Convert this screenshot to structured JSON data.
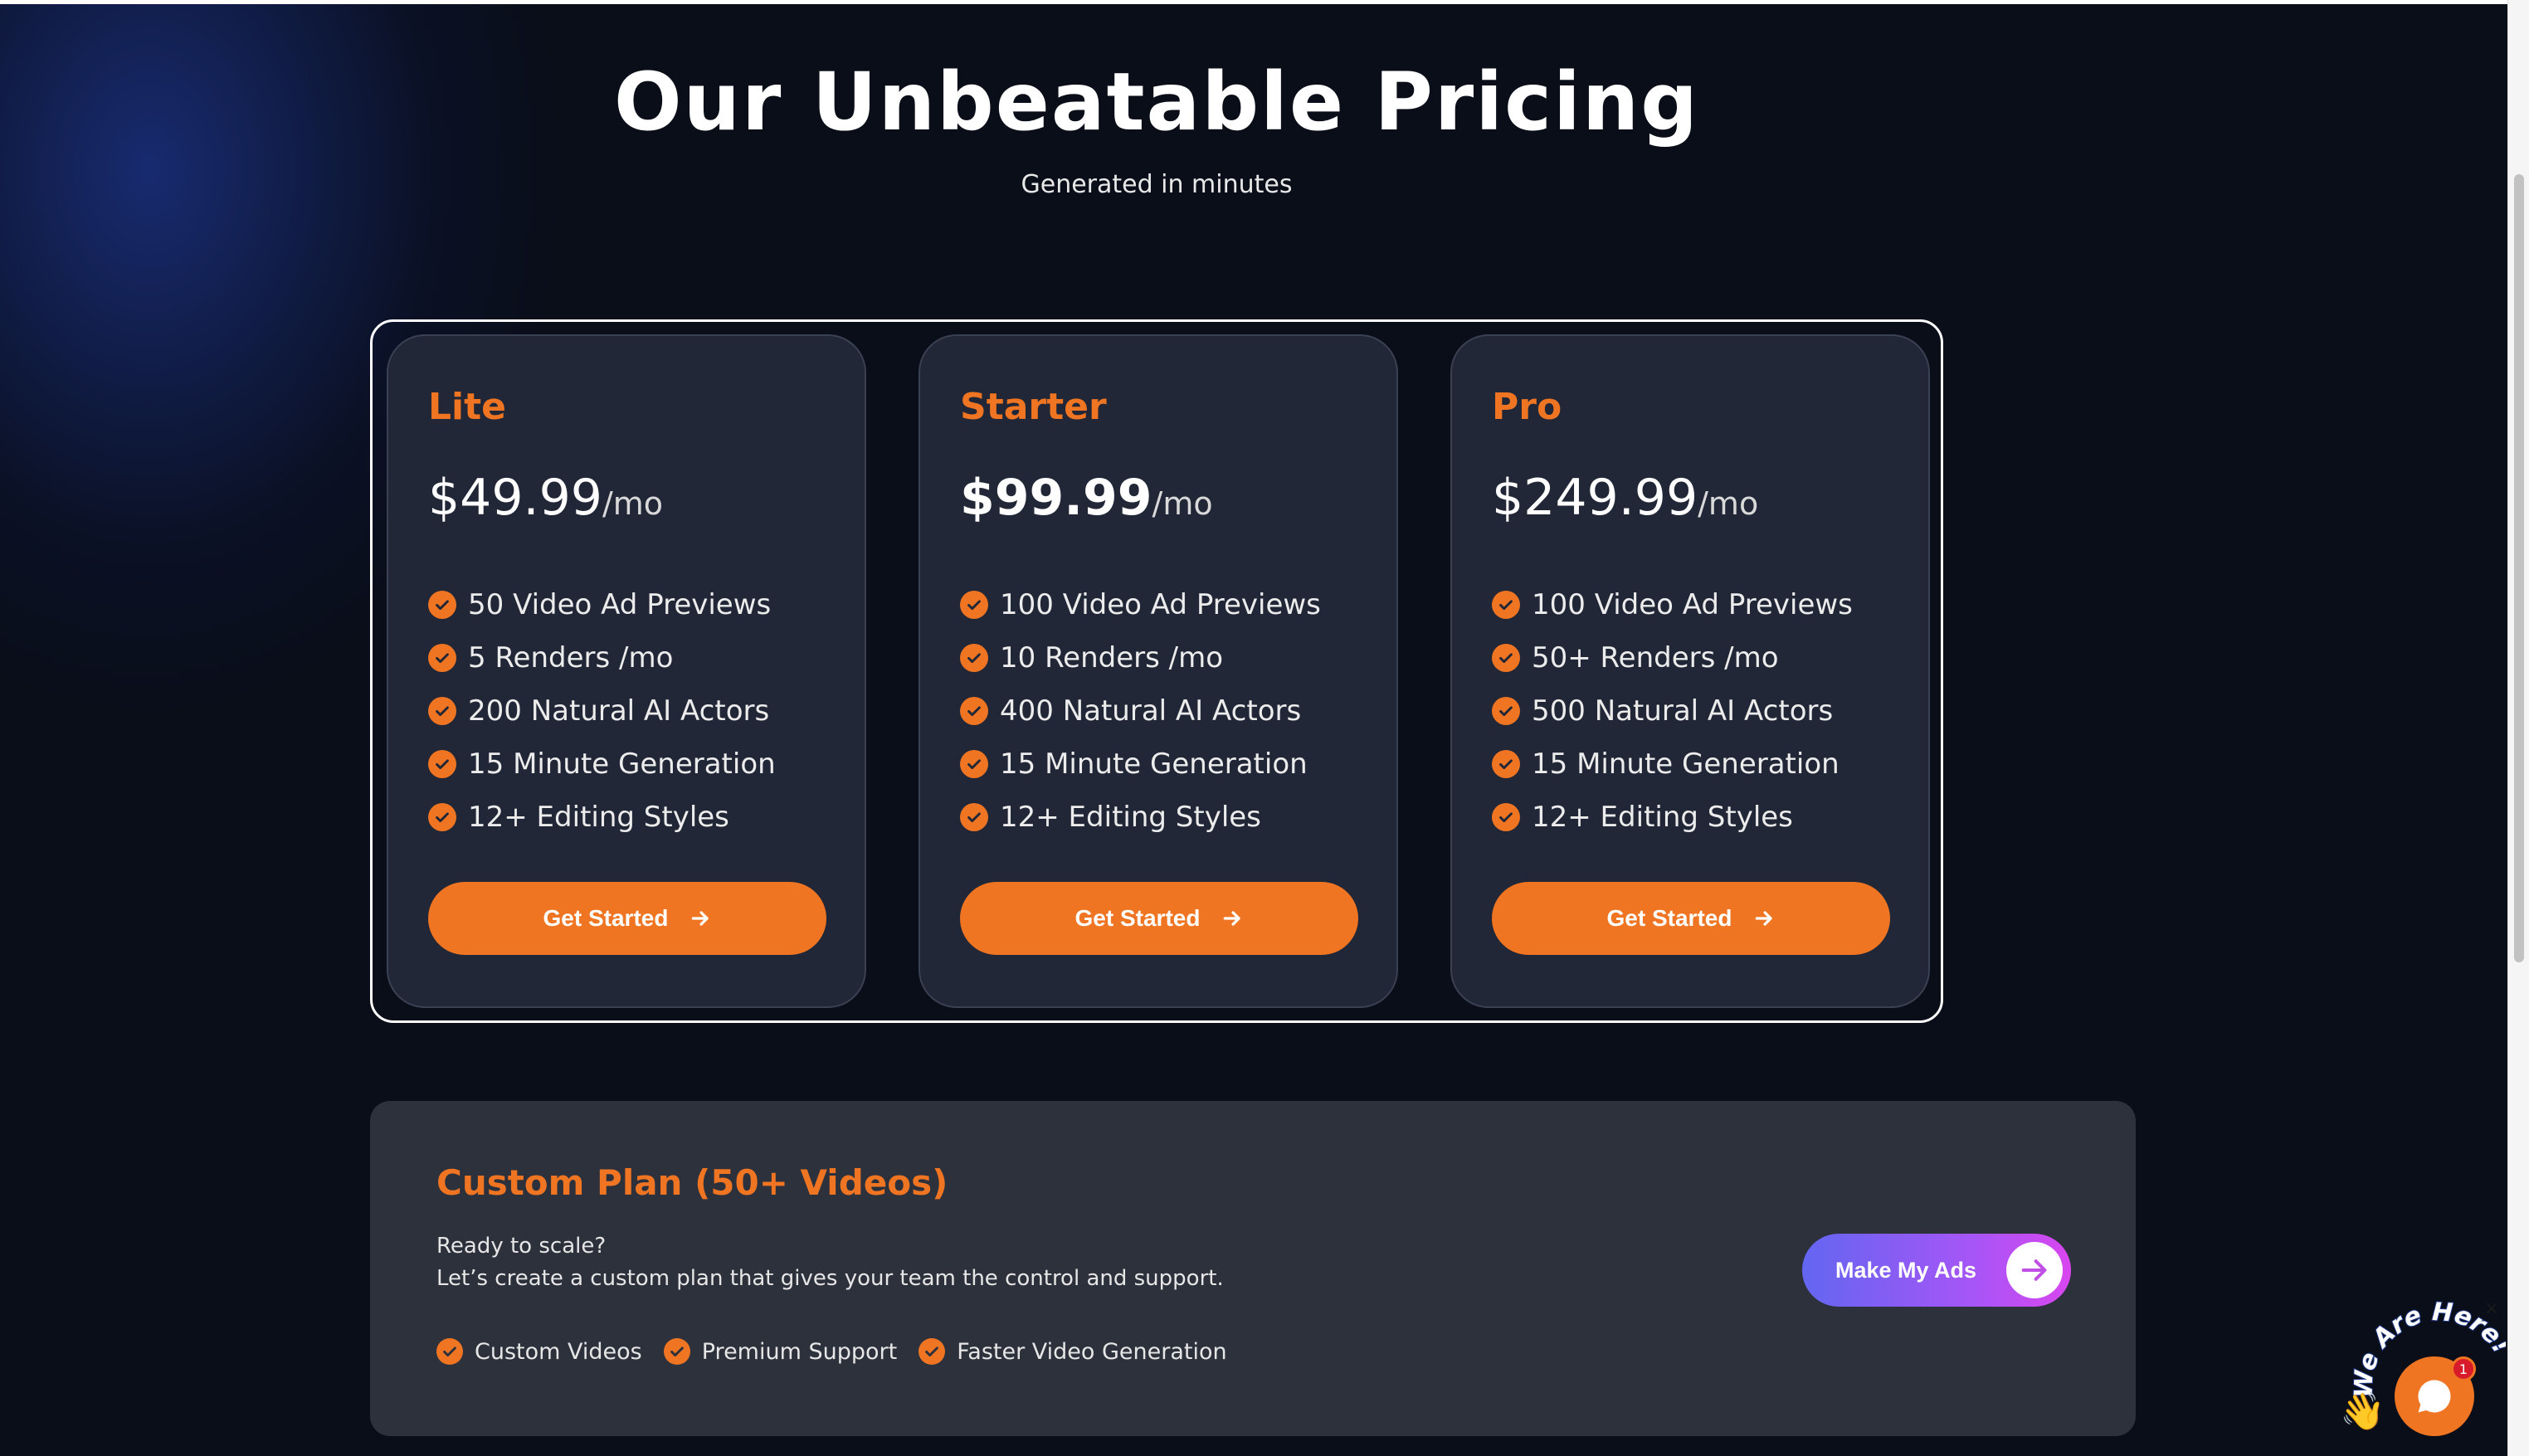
{
  "header": {
    "title": "Our Unbeatable Pricing",
    "subtitle": "Generated in minutes"
  },
  "plans": [
    {
      "name": "Lite",
      "price": "$49.99",
      "period": "/mo",
      "features": [
        "50 Video Ad Previews",
        "5 Renders /mo",
        "200 Natural AI Actors",
        "15 Minute Generation",
        "12+ Editing Styles"
      ],
      "cta_label": "Get Started"
    },
    {
      "name": "Starter",
      "price": "$99.99",
      "period": "/mo",
      "features": [
        "100 Video Ad Previews",
        "10 Renders /mo",
        "400 Natural AI Actors",
        "15 Minute Generation",
        "12+ Editing Styles"
      ],
      "cta_label": "Get Started"
    },
    {
      "name": "Pro",
      "price": "$249.99",
      "period": "/mo",
      "features": [
        "100 Video Ad Previews",
        "50+ Renders /mo",
        "500 Natural AI Actors",
        "15 Minute Generation",
        "12+ Editing Styles"
      ],
      "cta_label": "Get Started"
    }
  ],
  "custom_plan": {
    "title": "Custom Plan (50+ Videos)",
    "line1": "Ready to scale?",
    "line2": "Let’s create a custom plan that gives your team the control and support.",
    "features": [
      "Custom Videos",
      "Premium Support",
      "Faster Video Generation"
    ],
    "cta_label": "Make My Ads"
  },
  "chat_widget": {
    "banner": "We Are Here!",
    "badge_count": "1",
    "close_label": "×"
  },
  "colors": {
    "accent": "#f07522",
    "background": "#0a0e19",
    "card": "#212736",
    "custom_panel": "#2d313c",
    "button_gradient": [
      "#6366f1",
      "#d946ef"
    ]
  },
  "icons": [
    "check-circle-icon",
    "arrow-right-icon",
    "chat-icon",
    "wave-hand-icon",
    "close-icon"
  ]
}
